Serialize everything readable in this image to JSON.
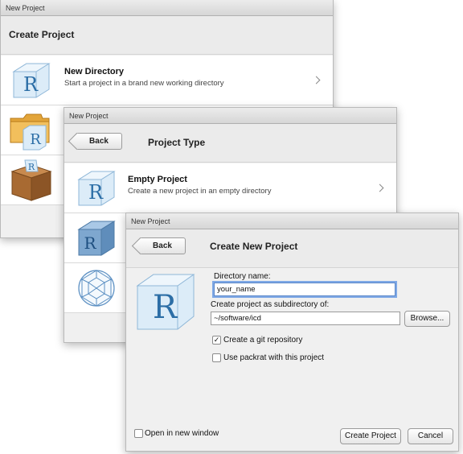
{
  "colors": {
    "r_blue": "#2c6ea6",
    "cube_light": "#cfe5f4",
    "focus_ring": "#7fa9e6"
  },
  "window1": {
    "title": "New Project",
    "header": "Create Project",
    "rows": [
      {
        "title": "New Directory",
        "subtitle": "Start a project in a brand new working directory",
        "icon": "r-cube-icon"
      },
      {
        "title": "",
        "subtitle": "",
        "icon": "folder-r-icon"
      },
      {
        "title": "",
        "subtitle": "",
        "icon": "package-box-icon"
      }
    ]
  },
  "window2": {
    "title": "New Project",
    "back_label": "Back",
    "header": "Project Type",
    "rows": [
      {
        "title": "Empty Project",
        "subtitle": "Create a new project in an empty directory",
        "icon": "r-cube-icon"
      },
      {
        "title": "",
        "subtitle": "",
        "icon": "r-package-cube-icon"
      },
      {
        "title": "",
        "subtitle": "",
        "icon": "shiny-sphere-icon"
      }
    ]
  },
  "window3": {
    "title": "New Project",
    "back_label": "Back",
    "header": "Create New Project",
    "directory_name_label": "Directory name:",
    "directory_name_value": "your_name",
    "subdir_label": "Create project as subdirectory of:",
    "subdir_value": "~/software/icd",
    "browse_label": "Browse...",
    "git_label": "Create a git repository",
    "git_checked": true,
    "packrat_label": "Use packrat with this project",
    "packrat_checked": false,
    "open_new_window_label": "Open in new window",
    "open_new_window_checked": false,
    "create_label": "Create Project",
    "cancel_label": "Cancel"
  }
}
